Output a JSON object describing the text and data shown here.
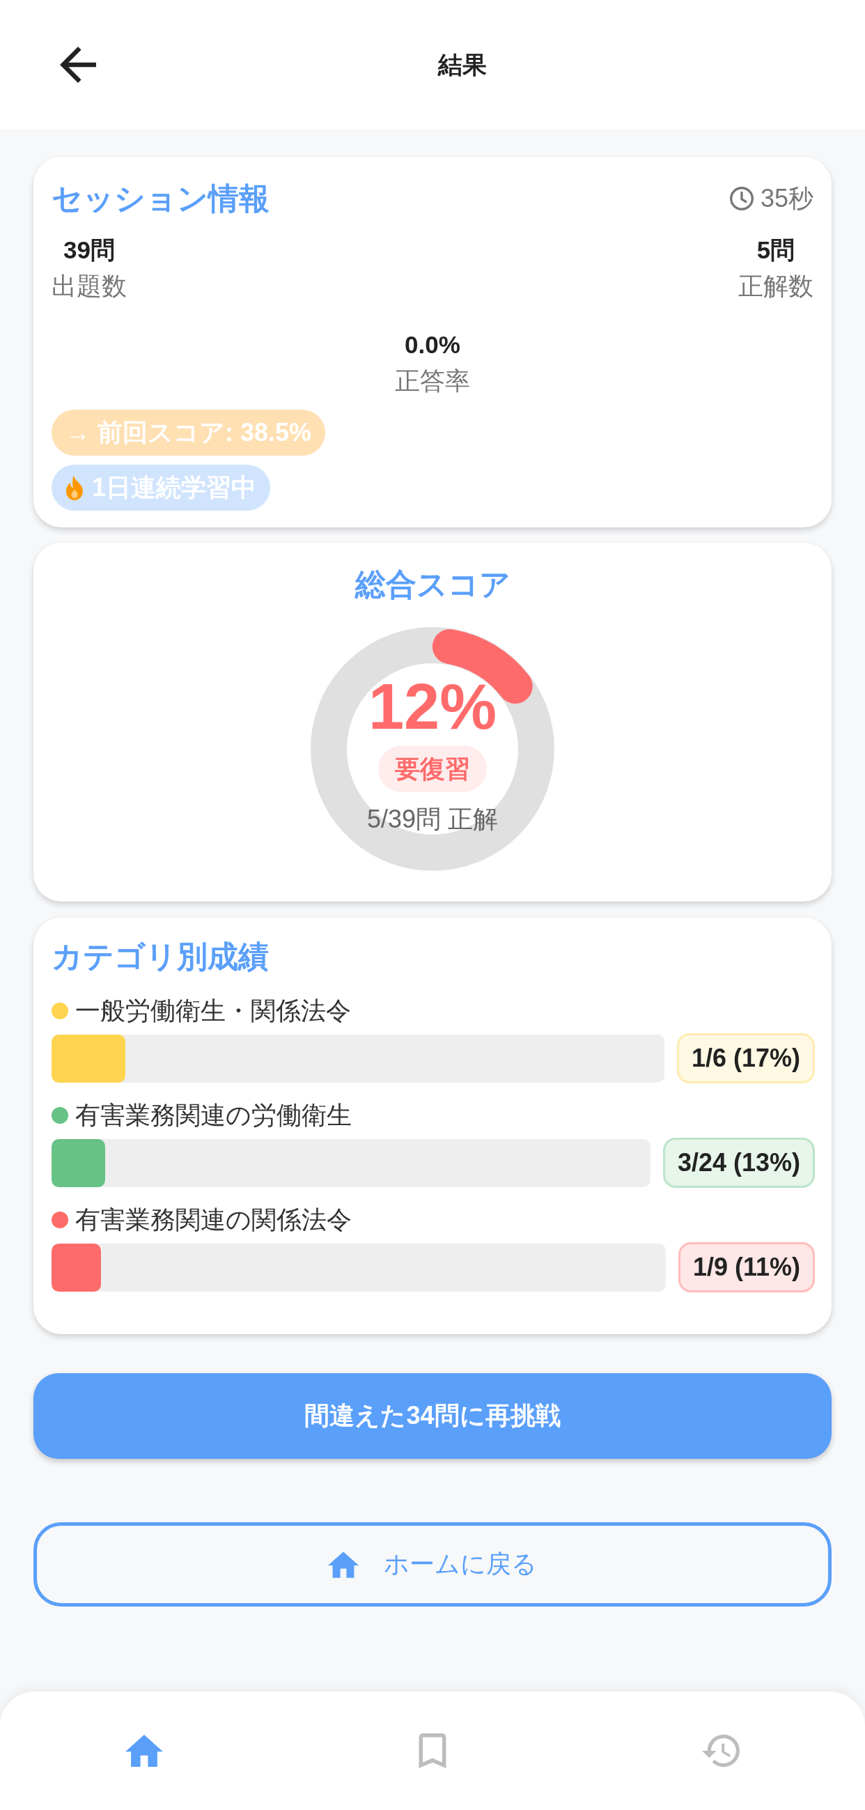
{
  "header": {
    "title": "結果"
  },
  "session": {
    "title": "セッション情報",
    "time": "35秒",
    "stats": [
      {
        "value": "39問",
        "label": "出題数"
      },
      {
        "value": "5問",
        "label": "正解数"
      }
    ],
    "rate": {
      "value": "0.0%",
      "label": "正答率"
    },
    "badges": [
      {
        "kind": "previous",
        "text": "→ 前回スコア: 38.5%"
      },
      {
        "kind": "streak",
        "text": "1日連続学習中"
      }
    ]
  },
  "score": {
    "title": "総合スコア",
    "level": 0.12,
    "percent": "12%",
    "status": "要復習",
    "detail": "5/39問 正解"
  },
  "categories": {
    "title": "カテゴリ別成績",
    "items": [
      {
        "name": "一般労働衛生・関係法令",
        "color": "#ffd54f",
        "level": 0.12,
        "result": "1/6 (17%)"
      },
      {
        "name": "有害業務関連の労働衛生",
        "color": "#66c285",
        "level": 0.09,
        "result": "3/24 (13%)"
      },
      {
        "name": "有害業務関連の関係法令",
        "color": "#ff6b6b",
        "level": 0.08,
        "result": "1/9 (11%)"
      }
    ]
  },
  "actions": {
    "retry": "間違えた34問に再挑戦",
    "home": "ホームに戻る"
  },
  "bottom_nav": [
    {
      "selected": true
    },
    {
      "selected": false
    },
    {
      "selected": false
    }
  ]
}
